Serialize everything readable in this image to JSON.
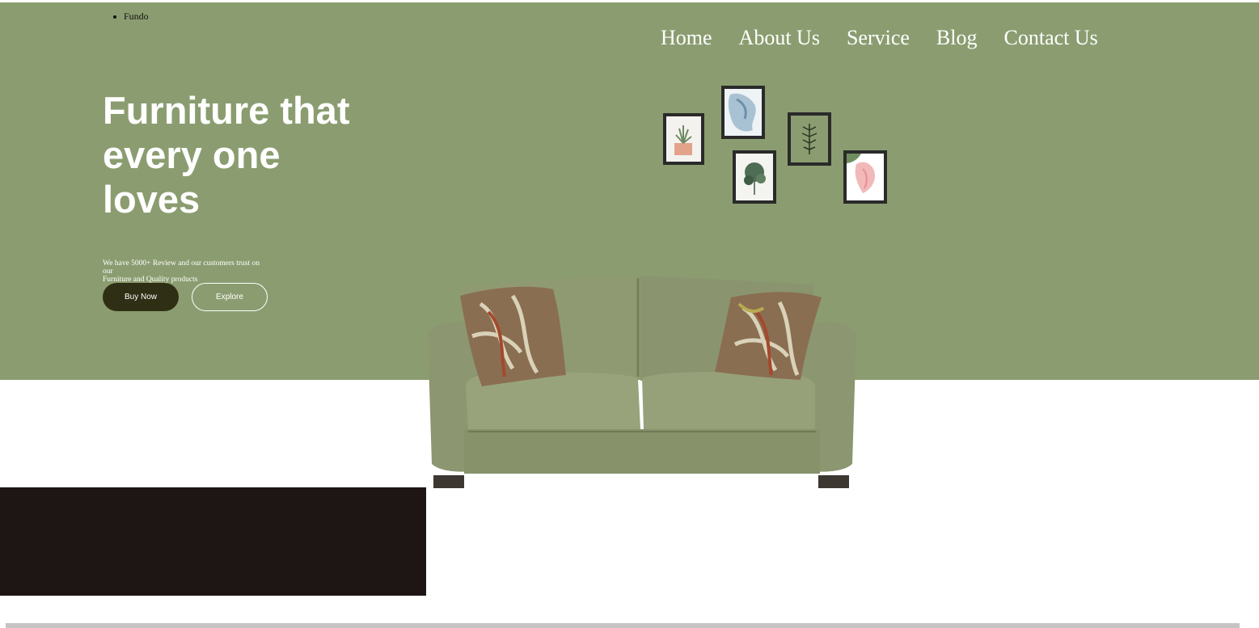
{
  "brand": {
    "items": [
      "Fundo"
    ]
  },
  "nav": {
    "items": [
      "Home",
      "About Us",
      "Service",
      "Blog",
      "Contact Us"
    ]
  },
  "hero": {
    "headline_line1": "Furniture that",
    "headline_line2": "every one",
    "headline_line3": "loves",
    "tagline_line1": "We have 5000+ Review and our customers trust on our",
    "tagline_line2": "Furniture and Quality products",
    "buy_label": "Buy Now",
    "explore_label": "Explore"
  },
  "colors": {
    "hero_bg": "#8b9d70",
    "buy_button_bg": "#2e2f14",
    "dark_block": "#1e1515",
    "sofa": "#8f9871"
  }
}
